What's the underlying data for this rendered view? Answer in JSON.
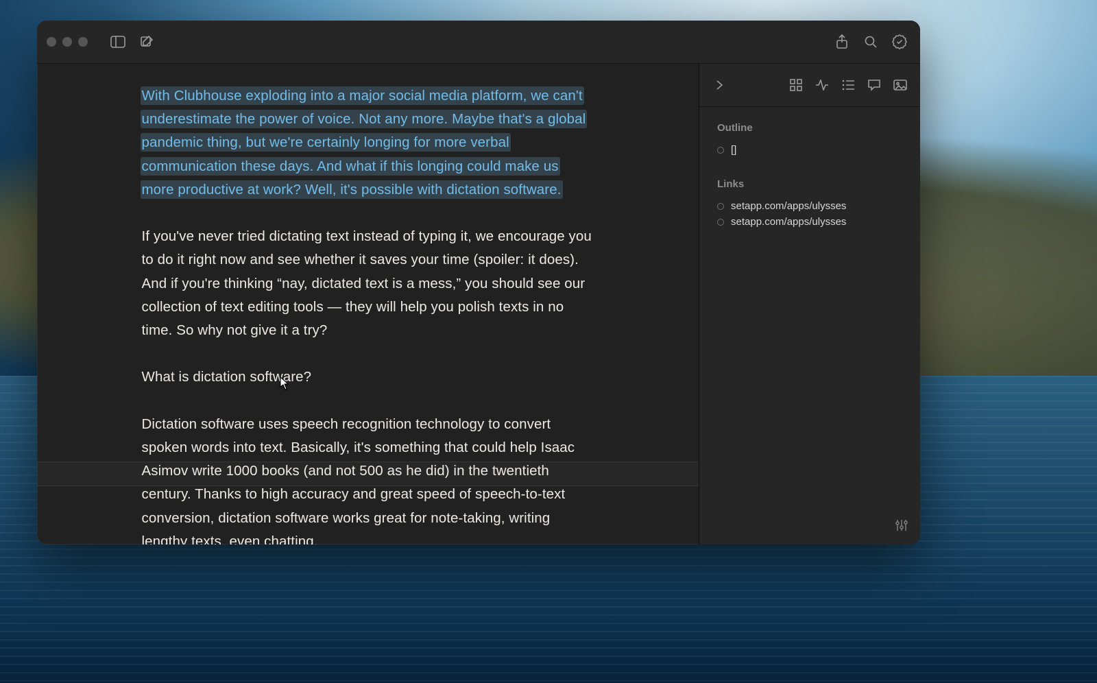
{
  "editor": {
    "selected_paragraph": "With Clubhouse exploding into a major social media platform, we can't underestimate the power of voice. Not any more. Maybe that's a global pandemic thing, but we're certainly longing for more verbal communication these days. And what if this longing could make us more productive at work? Well, it's possible with dictation software.",
    "paragraph2": "If you've never tried dictating text instead of typing it, we encourage you to do it right now and see whether it saves your time (spoiler: it does). And if you're thinking “nay, dictated text is a mess,” you should see our collection of text editing tools — they will help you polish texts in no time. So why not give it a try?",
    "heading": "What is dictation software?",
    "paragraph3": "Dictation software uses speech recognition technology to convert spoken words into text. Basically, it's something that could help Isaac Asimov write 1000 books (and not 500 as he did) in the twentieth century. Thanks to high accuracy and great speed of speech-to-text conversion, dictation software works great for note-taking, writing lengthy texts, even chatting."
  },
  "sidebar": {
    "outline_label": "Outline",
    "outline_items": [
      "[]"
    ],
    "links_label": "Links",
    "links": [
      "setapp.com/apps/ulysses",
      "setapp.com/apps/ulysses"
    ]
  },
  "icons": {
    "sidebar_toggle": "sidebar-toggle-icon",
    "compose": "compose-icon",
    "share": "share-icon",
    "search": "search-icon",
    "review": "review-badge-icon",
    "panel_collapse": "chevron-right-icon",
    "grid": "grid-icon",
    "stats": "activity-icon",
    "list": "list-icon",
    "comment": "comment-icon",
    "image": "image-icon",
    "equalizer": "sliders-icon"
  }
}
